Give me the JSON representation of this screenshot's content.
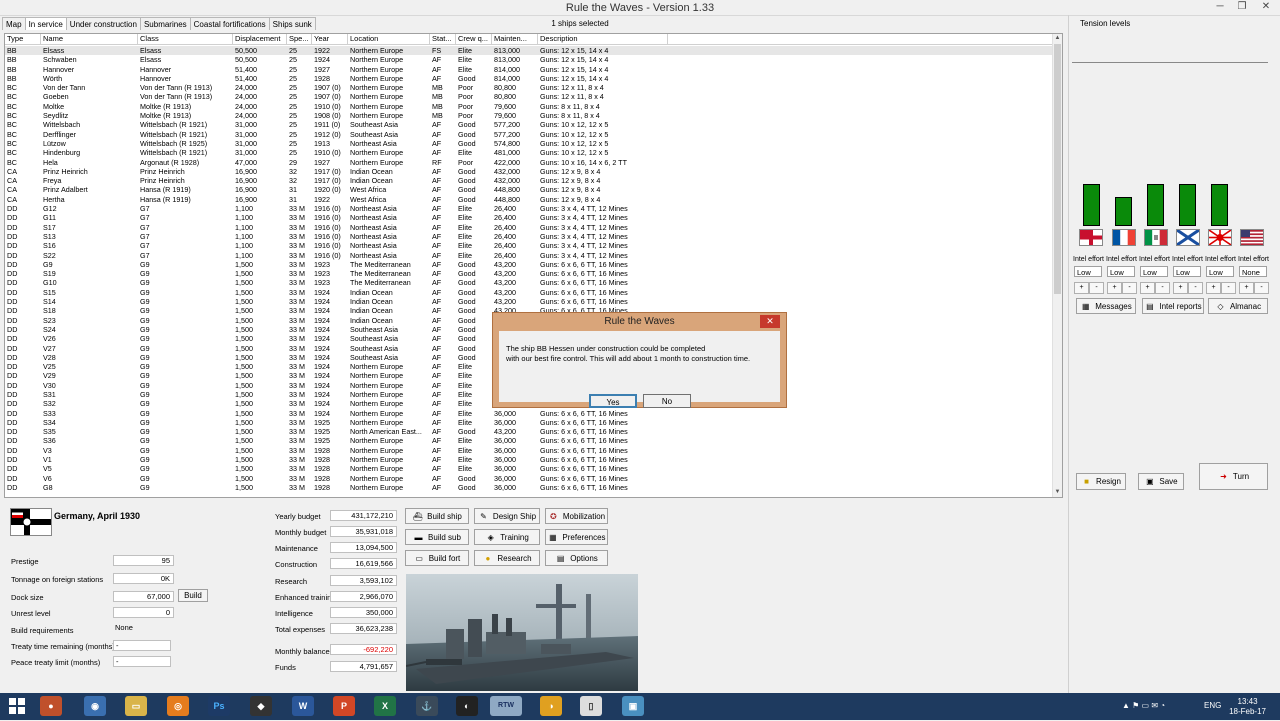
{
  "window": {
    "title": "Rule the Waves - Version 1.33"
  },
  "tabs": [
    "Map",
    "In service",
    "Under construction",
    "Submarines",
    "Coastal fortifications",
    "Ships sunk"
  ],
  "selected_info": "1 ships selected",
  "tension_label": "Tension levels",
  "columns": [
    "Type",
    "Name",
    "Class",
    "Displacement",
    "Spe...",
    "Year",
    "Location",
    "Stat...",
    "Crew q...",
    "Mainten...",
    "Description"
  ],
  "ships": [
    [
      "BB",
      "Elsass",
      "Elsass",
      "50,500",
      "25",
      "1922",
      "Northern Europe",
      "FS",
      "Elite",
      "813,000",
      "Guns: 12 x 15, 14 x 4"
    ],
    [
      "BB",
      "Schwaben",
      "Elsass",
      "50,500",
      "25",
      "1924",
      "Northern Europe",
      "AF",
      "Elite",
      "813,000",
      "Guns: 12 x 15, 14 x 4"
    ],
    [
      "BB",
      "Hannover",
      "Hannover",
      "51,400",
      "25",
      "1927",
      "Northern Europe",
      "AF",
      "Elite",
      "814,000",
      "Guns: 12 x 15, 14 x 4"
    ],
    [
      "BB",
      "Wörth",
      "Hannover",
      "51,400",
      "25",
      "1928",
      "Northern Europe",
      "AF",
      "Good",
      "814,000",
      "Guns: 12 x 15, 14 x 4"
    ],
    [
      "BC",
      "Von der Tann",
      "Von der Tann (R 1913)",
      "24,000",
      "25",
      "1907 (0)",
      "Northern Europe",
      "MB",
      "Poor",
      "80,800",
      "Guns: 12 x 11, 8 x 4"
    ],
    [
      "BC",
      "Goeben",
      "Von der Tann (R 1913)",
      "24,000",
      "25",
      "1907 (0)",
      "Northern Europe",
      "MB",
      "Poor",
      "80,800",
      "Guns: 12 x 11, 8 x 4"
    ],
    [
      "BC",
      "Moltke",
      "Moltke (R 1913)",
      "24,000",
      "25",
      "1910 (0)",
      "Northern Europe",
      "MB",
      "Poor",
      "79,600",
      "Guns: 8 x 11, 8 x 4"
    ],
    [
      "BC",
      "Seydlitz",
      "Moltke (R 1913)",
      "24,000",
      "25",
      "1908 (0)",
      "Northern Europe",
      "MB",
      "Poor",
      "79,600",
      "Guns: 8 x 11, 8 x 4"
    ],
    [
      "BC",
      "Wittelsbach",
      "Wittelsbach (R 1921)",
      "31,000",
      "25",
      "1911 (0)",
      "Southeast Asia",
      "AF",
      "Good",
      "577,200",
      "Guns: 10 x 12, 12 x 5"
    ],
    [
      "BC",
      "Derfflinger",
      "Wittelsbach (R 1921)",
      "31,000",
      "25",
      "1912 (0)",
      "Southeast Asia",
      "AF",
      "Good",
      "577,200",
      "Guns: 10 x 12, 12 x 5"
    ],
    [
      "BC",
      "Lützow",
      "Wittelsbach (R 1925)",
      "31,000",
      "25",
      "1913",
      "Northeast Asia",
      "AF",
      "Good",
      "574,800",
      "Guns: 10 x 12, 12 x 5"
    ],
    [
      "BC",
      "Hindenburg",
      "Wittelsbach (R 1921)",
      "31,000",
      "25",
      "1910 (0)",
      "Northern Europe",
      "AF",
      "Elite",
      "481,000",
      "Guns: 10 x 12, 12 x 5"
    ],
    [
      "BC",
      "Hela",
      "Argonaut (R 1928)",
      "47,000",
      "29",
      "1927",
      "Northern Europe",
      "RF",
      "Poor",
      "422,000",
      "Guns: 10 x 16, 14 x 6, 2 TT"
    ],
    [
      "CA",
      "Prinz Heinrich",
      "Prinz Heinrich",
      "16,900",
      "32",
      "1917 (0)",
      "Indian Ocean",
      "AF",
      "Good",
      "432,000",
      "Guns: 12 x 9, 8 x 4"
    ],
    [
      "CA",
      "Freya",
      "Prinz Heinrich",
      "16,900",
      "32",
      "1917 (0)",
      "Indian Ocean",
      "AF",
      "Good",
      "432,000",
      "Guns: 12 x 9, 8 x 4"
    ],
    [
      "CA",
      "Prinz Adalbert",
      "Hansa (R 1919)",
      "16,900",
      "31",
      "1920 (0)",
      "West Africa",
      "AF",
      "Good",
      "448,800",
      "Guns: 12 x 9, 8 x 4"
    ],
    [
      "CA",
      "Hertha",
      "Hansa (R 1919)",
      "16,900",
      "31",
      "1922",
      "West Africa",
      "AF",
      "Good",
      "448,800",
      "Guns: 12 x 9, 8 x 4"
    ],
    [
      "DD",
      "G12",
      "G7",
      "1,100",
      "33 M",
      "1916 (0)",
      "Northeast Asia",
      "AF",
      "Elite",
      "26,400",
      "Guns: 3 x 4, 4 TT, 12 Mines"
    ],
    [
      "DD",
      "G11",
      "G7",
      "1,100",
      "33 M",
      "1916 (0)",
      "Northeast Asia",
      "AF",
      "Elite",
      "26,400",
      "Guns: 3 x 4, 4 TT, 12 Mines"
    ],
    [
      "DD",
      "S17",
      "G7",
      "1,100",
      "33 M",
      "1916 (0)",
      "Northeast Asia",
      "AF",
      "Elite",
      "26,400",
      "Guns: 3 x 4, 4 TT, 12 Mines"
    ],
    [
      "DD",
      "S13",
      "G7",
      "1,100",
      "33 M",
      "1916 (0)",
      "Northeast Asia",
      "AF",
      "Elite",
      "26,400",
      "Guns: 3 x 4, 4 TT, 12 Mines"
    ],
    [
      "DD",
      "S16",
      "G7",
      "1,100",
      "33 M",
      "1916 (0)",
      "Northeast Asia",
      "AF",
      "Elite",
      "26,400",
      "Guns: 3 x 4, 4 TT, 12 Mines"
    ],
    [
      "DD",
      "S22",
      "G7",
      "1,100",
      "33 M",
      "1916 (0)",
      "Northeast Asia",
      "AF",
      "Elite",
      "26,400",
      "Guns: 3 x 4, 4 TT, 12 Mines"
    ],
    [
      "DD",
      "G9",
      "G9",
      "1,500",
      "33 M",
      "1923",
      "The Mediterranean",
      "AF",
      "Good",
      "43,200",
      "Guns: 6 x 6, 6 TT, 16 Mines"
    ],
    [
      "DD",
      "S19",
      "G9",
      "1,500",
      "33 M",
      "1923",
      "The Mediterranean",
      "AF",
      "Good",
      "43,200",
      "Guns: 6 x 6, 6 TT, 16 Mines"
    ],
    [
      "DD",
      "G10",
      "G9",
      "1,500",
      "33 M",
      "1923",
      "The Mediterranean",
      "AF",
      "Good",
      "43,200",
      "Guns: 6 x 6, 6 TT, 16 Mines"
    ],
    [
      "DD",
      "S15",
      "G9",
      "1,500",
      "33 M",
      "1924",
      "Indian Ocean",
      "AF",
      "Good",
      "43,200",
      "Guns: 6 x 6, 6 TT, 16 Mines"
    ],
    [
      "DD",
      "S14",
      "G9",
      "1,500",
      "33 M",
      "1924",
      "Indian Ocean",
      "AF",
      "Good",
      "43,200",
      "Guns: 6 x 6, 6 TT, 16 Mines"
    ],
    [
      "DD",
      "S18",
      "G9",
      "1,500",
      "33 M",
      "1924",
      "Indian Ocean",
      "AF",
      "Good",
      "43,200",
      "Guns: 6 x 6, 6 TT, 16 Mines"
    ],
    [
      "DD",
      "S23",
      "G9",
      "1,500",
      "33 M",
      "1924",
      "Indian Ocean",
      "AF",
      "Good",
      "43,200",
      "Guns: 6 x 6, 6 TT, 16 Mines"
    ],
    [
      "DD",
      "S24",
      "G9",
      "1,500",
      "33 M",
      "1924",
      "Southeast Asia",
      "AF",
      "Good",
      "43,200",
      "Guns: 6 x 6, 6 TT, 16 Mines"
    ],
    [
      "DD",
      "V26",
      "G9",
      "1,500",
      "33 M",
      "1924",
      "Southeast Asia",
      "AF",
      "Good",
      "43,200",
      "Guns: 6 x 6, 6 TT, 16 Mines"
    ],
    [
      "DD",
      "V27",
      "G9",
      "1,500",
      "33 M",
      "1924",
      "Southeast Asia",
      "AF",
      "Good",
      "43,200",
      "Guns: 6 x 6, 6 TT, 16 Mines"
    ],
    [
      "DD",
      "V28",
      "G9",
      "1,500",
      "33 M",
      "1924",
      "Southeast Asia",
      "AF",
      "Good",
      "43,200",
      "Guns: 6 x 6, 6 TT, 16 Mines"
    ],
    [
      "DD",
      "V25",
      "G9",
      "1,500",
      "33 M",
      "1924",
      "Northern Europe",
      "AF",
      "Elite",
      "36,000",
      "Guns: 6 x 6, 6 TT, 16 Mines"
    ],
    [
      "DD",
      "V29",
      "G9",
      "1,500",
      "33 M",
      "1924",
      "Northern Europe",
      "AF",
      "Elite",
      "36,000",
      "Guns: 6 x 6, 6 TT, 16 Mines"
    ],
    [
      "DD",
      "V30",
      "G9",
      "1,500",
      "33 M",
      "1924",
      "Northern Europe",
      "AF",
      "Elite",
      "36,000",
      "Guns: 6 x 6, 6 TT, 16 Mines"
    ],
    [
      "DD",
      "S31",
      "G9",
      "1,500",
      "33 M",
      "1924",
      "Northern Europe",
      "AF",
      "Elite",
      "36,000",
      "Guns: 6 x 6, 6 TT, 16 Mines"
    ],
    [
      "DD",
      "S32",
      "G9",
      "1,500",
      "33 M",
      "1924",
      "Northern Europe",
      "AF",
      "Elite",
      "36,000",
      "Guns: 6 x 6, 6 TT, 16 Mines"
    ],
    [
      "DD",
      "S33",
      "G9",
      "1,500",
      "33 M",
      "1924",
      "Northern Europe",
      "AF",
      "Elite",
      "36,000",
      "Guns: 6 x 6, 6 TT, 16 Mines"
    ],
    [
      "DD",
      "S34",
      "G9",
      "1,500",
      "33 M",
      "1925",
      "Northern Europe",
      "AF",
      "Elite",
      "36,000",
      "Guns: 6 x 6, 6 TT, 16 Mines"
    ],
    [
      "DD",
      "S35",
      "G9",
      "1,500",
      "33 M",
      "1925",
      "North American East...",
      "AF",
      "Good",
      "43,200",
      "Guns: 6 x 6, 6 TT, 16 Mines"
    ],
    [
      "DD",
      "S36",
      "G9",
      "1,500",
      "33 M",
      "1925",
      "Northern Europe",
      "AF",
      "Elite",
      "36,000",
      "Guns: 6 x 6, 6 TT, 16 Mines"
    ],
    [
      "DD",
      "V3",
      "G9",
      "1,500",
      "33 M",
      "1928",
      "Northern Europe",
      "AF",
      "Elite",
      "36,000",
      "Guns: 6 x 6, 6 TT, 16 Mines"
    ],
    [
      "DD",
      "V1",
      "G9",
      "1,500",
      "33 M",
      "1928",
      "Northern Europe",
      "AF",
      "Elite",
      "36,000",
      "Guns: 6 x 6, 6 TT, 16 Mines"
    ],
    [
      "DD",
      "V5",
      "G9",
      "1,500",
      "33 M",
      "1928",
      "Northern Europe",
      "AF",
      "Elite",
      "36,000",
      "Guns: 6 x 6, 6 TT, 16 Mines"
    ],
    [
      "DD",
      "V6",
      "G9",
      "1,500",
      "33 M",
      "1928",
      "Northern Europe",
      "AF",
      "Good",
      "36,000",
      "Guns: 6 x 6, 6 TT, 16 Mines"
    ],
    [
      "DD",
      "G8",
      "G9",
      "1,500",
      "33 M",
      "1928",
      "Northern Europe",
      "AF",
      "Good",
      "36,000",
      "Guns: 6 x 6, 6 TT, 16 Mines"
    ]
  ],
  "nation": {
    "title": "Germany, April 1930"
  },
  "stats": {
    "prestige_label": "Prestige",
    "prestige": "95",
    "tonnage_label": "Tonnage on foreign stations",
    "tonnage": "0K",
    "dock_label": "Dock size",
    "dock": "67,000",
    "build_label": "Build",
    "unrest_label": "Unrest level",
    "unrest": "0",
    "buildreq_label": "Build requirements",
    "buildreq": "None",
    "treaty_label": "Treaty time remaining (months)",
    "treaty": "-",
    "peace_label": "Peace treaty limit (months)",
    "peace": "-"
  },
  "budget": {
    "yearly_label": "Yearly budget",
    "yearly": "431,172,210",
    "monthly_label": "Monthly budget",
    "monthly": "35,931,018",
    "maint_label": "Maintenance",
    "maint": "13,094,500",
    "constr_label": "Construction",
    "constr": "16,619,566",
    "research_label": "Research",
    "research": "3,593,102",
    "training_label": "Enhanced training",
    "training": "2,966,070",
    "intel_label": "Intelligence",
    "intel": "350,000",
    "total_label": "Total expenses",
    "total": "36,623,238",
    "balance_label": "Monthly balance",
    "balance": "-692,220",
    "funds_label": "Funds",
    "funds": "4,791,657"
  },
  "actions": {
    "build_ship": "Build ship",
    "design_ship": "Design Ship",
    "mobilization": "Mobilization",
    "build_sub": "Build sub",
    "training": "Training",
    "preferences": "Preferences",
    "build_fort": "Build fort",
    "research": "Research",
    "options": "Options"
  },
  "intel": {
    "label": "Intel effort",
    "values": [
      "Low",
      "Low",
      "Low",
      "Low",
      "Low",
      "None"
    ],
    "tension": [
      0.57,
      0.38,
      0.57,
      0.57,
      0.57,
      0.0
    ]
  },
  "right_buttons": {
    "messages": "Messages",
    "intel_reports": "Intel reports",
    "almanac": "Almanac",
    "resign": "Resign",
    "save": "Save",
    "turn": "Turn"
  },
  "dialog": {
    "title": "Rule the Waves",
    "line1": "The ship BB Hessen under construction could be completed",
    "line2": "with our best fire control. This will add about 1 month to construction time.",
    "yes": "Yes",
    "no": "No",
    "close": "✕"
  },
  "taskbar": {
    "lang": "ENG",
    "time": "13:43",
    "date": "18-Feb-17"
  }
}
